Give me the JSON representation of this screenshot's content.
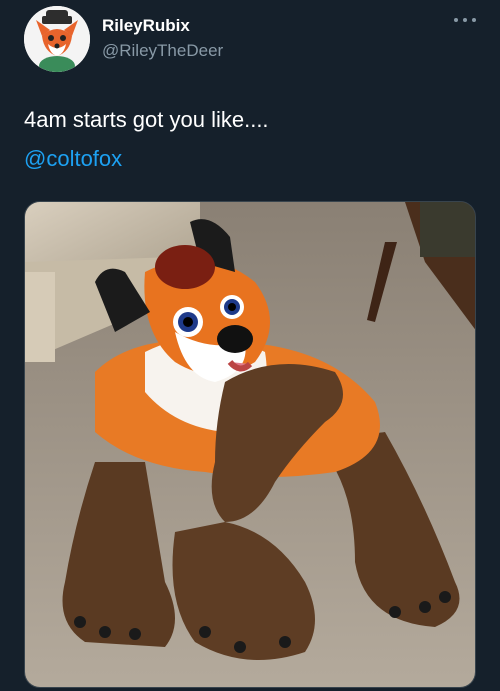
{
  "tweet": {
    "display_name": "RileyRubix",
    "handle": "@RileyTheDeer",
    "text": "4am starts got you like....",
    "mention": "@coltofox"
  },
  "icons": {
    "more": "more-options-icon"
  },
  "colors": {
    "background": "#15202b",
    "text": "#ffffff",
    "secondary": "#8899a6",
    "link": "#1da1f2"
  },
  "media": {
    "description_type": "photo"
  }
}
